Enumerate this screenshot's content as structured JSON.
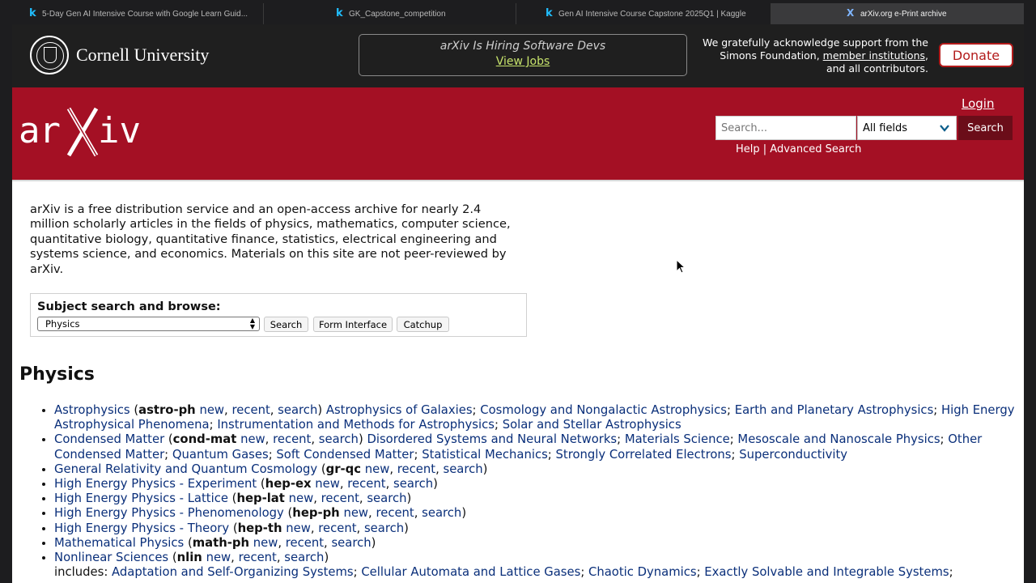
{
  "tabs": [
    {
      "label": "5-Day Gen AI Intensive Course with Google Learn Guid...",
      "icon": "kaggle-k"
    },
    {
      "label": "GK_Capstone_competition",
      "icon": "kaggle-k"
    },
    {
      "label": "Gen AI Intensive Course Capstone 2025Q1 | Kaggle",
      "icon": "kaggle-k"
    },
    {
      "label": "arXiv.org e-Print archive",
      "icon": "arxiv-x"
    }
  ],
  "header": {
    "cornell": "Cornell University",
    "hiring": "arXiv Is Hiring Software Devs",
    "view_jobs": "View Jobs",
    "ack_1": "We gratefully acknowledge support from the",
    "ack_2": "Simons Foundation,",
    "ack_link": "member institutions",
    "ack_3": ",",
    "ack_4": "and all contributors.",
    "donate": "Donate"
  },
  "banner": {
    "login": "Login",
    "search_placeholder": "Search...",
    "field": "All fields",
    "search_button": "Search",
    "help": "Help",
    "separator": " | ",
    "advanced": "Advanced Search"
  },
  "intro": "arXiv is a free distribution service and an open-access archive for nearly 2.4 million scholarly articles in the fields of physics, mathematics, computer science, quantitative biology, quantitative finance, statistics, electrical engineering and systems science, and economics. Materials on this site are not peer-reviewed by arXiv.",
  "subject": {
    "label": "Subject search and browse:",
    "selected": "Physics",
    "search": "Search",
    "form": "Form Interface",
    "catchup": "Catchup"
  },
  "section_title": "Physics",
  "archives": [
    {
      "name": "Astrophysics",
      "code": "astro-ph",
      "subs": [
        "Astrophysics of Galaxies",
        "Cosmology and Nongalactic Astrophysics",
        "Earth and Planetary Astrophysics",
        "High Energy Astrophysical Phenomena",
        "Instrumentation and Methods for Astrophysics",
        "Solar and Stellar Astrophysics"
      ]
    },
    {
      "name": "Condensed Matter",
      "code": "cond-mat",
      "subs": [
        "Disordered Systems and Neural Networks",
        "Materials Science",
        "Mesoscale and Nanoscale Physics",
        "Other Condensed Matter",
        "Quantum Gases",
        "Soft Condensed Matter",
        "Statistical Mechanics",
        "Strongly Correlated Electrons",
        "Superconductivity"
      ]
    },
    {
      "name": "General Relativity and Quantum Cosmology",
      "code": "gr-qc",
      "subs": []
    },
    {
      "name": "High Energy Physics - Experiment",
      "code": "hep-ex",
      "subs": []
    },
    {
      "name": "High Energy Physics - Lattice",
      "code": "hep-lat",
      "subs": []
    },
    {
      "name": "High Energy Physics - Phenomenology",
      "code": "hep-ph",
      "subs": []
    },
    {
      "name": "High Energy Physics - Theory",
      "code": "hep-th",
      "subs": []
    },
    {
      "name": "Mathematical Physics",
      "code": "math-ph",
      "subs": []
    },
    {
      "name": "Nonlinear Sciences",
      "code": "nlin",
      "subs": [],
      "includes_label": "includes:",
      "includes": [
        "Adaptation and Self-Organizing Systems",
        "Cellular Automata and Lattice Gases",
        "Chaotic Dynamics",
        "Exactly Solvable and Integrable Systems"
      ]
    }
  ],
  "link_words": {
    "new": "new",
    "recent": "recent",
    "search": "search",
    "open": " (",
    "close": ")"
  },
  "colors": {
    "arxiv_red": "#a41024",
    "link": "#0a2f7a",
    "topbar": "#1f1f1f",
    "jobs_link": "#c6e26b"
  }
}
